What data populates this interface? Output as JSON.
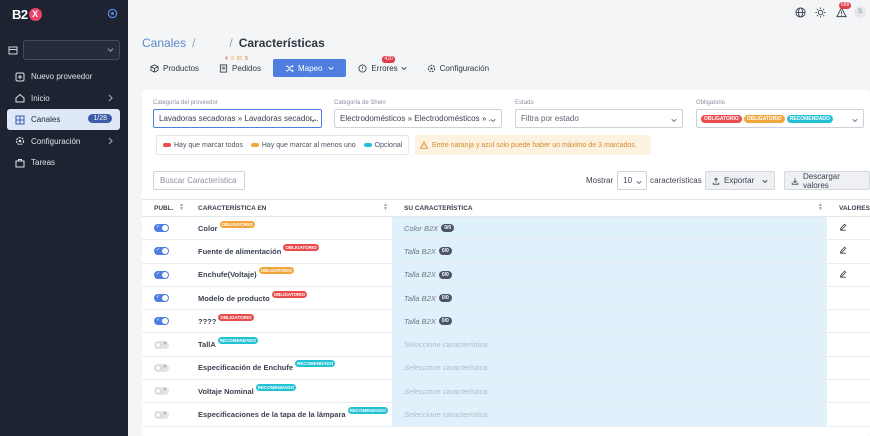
{
  "brand": {
    "logo_text": "B2",
    "logo_x": "X"
  },
  "sidebar": {
    "items": [
      {
        "label": "Nuevo proveedor",
        "icon": "plus-square-icon",
        "has_chevron": false
      },
      {
        "label": "Inicio",
        "icon": "home-icon",
        "has_chevron": true
      },
      {
        "label": "Canales",
        "icon": "grid-icon",
        "badge": "1/28",
        "active": true
      },
      {
        "label": "Configuración",
        "icon": "gear-icon",
        "has_chevron": true
      },
      {
        "label": "Tareas",
        "icon": "briefcase-icon",
        "has_chevron": false
      }
    ]
  },
  "topbar": {
    "notif_count": "688",
    "avatar_initial": "S"
  },
  "breadcrumb": {
    "root": "Canales",
    "sep1": "/",
    "sep2": "/",
    "title": "Características"
  },
  "tabs": [
    {
      "label": "Productos",
      "icon": "box-icon"
    },
    {
      "label": "Pedidos",
      "icon": "receipt-icon",
      "nums": [
        "4",
        "9",
        "85",
        "5"
      ]
    },
    {
      "label": "Mapeo",
      "icon": "shuffle-icon",
      "active": true
    },
    {
      "label": "Errores",
      "icon": "alert-circle-icon",
      "badge": "420"
    },
    {
      "label": "Configuración",
      "icon": "gear-icon"
    }
  ],
  "filters": {
    "provider_category": {
      "label": "Categoría del proveedor",
      "value": "Lavadoras secadoras » Lavadoras secador..."
    },
    "shein_category": {
      "label": "Categoría de Shein",
      "value": "Electrodomésticos » Electrodomésticos » ..."
    },
    "state": {
      "label": "Estado",
      "value": "Filtra por estado"
    },
    "required": {
      "label": "Obligatorio",
      "tags": [
        "OBLIGATORIO",
        "OBLIGATORIO",
        "RECOMENDADO"
      ]
    }
  },
  "legend": {
    "items": [
      {
        "label": "Hay que marcar todos",
        "color": "#e84c4c"
      },
      {
        "label": "Hay que marcar al menos uno",
        "color": "#f0a63a"
      },
      {
        "label": "Opcional",
        "color": "#22c1d6"
      }
    ],
    "warning": "Entre naranja y azul solo puede haber un máximo de 3 marcados."
  },
  "toolbar": {
    "search_placeholder": "Buscar Característica",
    "show_label": "Mostrar",
    "show_value": "10",
    "show_suffix": "características",
    "export_label": "Exportar",
    "download_label": "Descargar valores"
  },
  "table": {
    "headers": {
      "publ": "PUBL.",
      "char_en": "CARACTERÍSTICA EN",
      "your_char": "SU CARACTERÍSTICA",
      "values": "VALORES"
    },
    "rows": [
      {
        "name": "Color",
        "tag": "OBLIGATORIO",
        "tag_color": "#f0a63a",
        "on": true,
        "mapped": "Color B2X",
        "count": "0/0",
        "edit": true
      },
      {
        "name": "Fuente de alimentación",
        "tag": "OBLIGATORIO",
        "tag_color": "#e84c4c",
        "on": true,
        "mapped": "Talla B2X",
        "count": "0/0",
        "edit": true
      },
      {
        "name": "Enchufe(Voltaje)",
        "tag": "OBLIGATORIO",
        "tag_color": "#f0a63a",
        "on": true,
        "mapped": "Talla B2X",
        "count": "0/0",
        "edit": true
      },
      {
        "name": "Modelo de producto",
        "tag": "OBLIGATORIO",
        "tag_color": "#e84c4c",
        "on": true,
        "mapped": "Talla B2X",
        "count": "0/0",
        "edit": false
      },
      {
        "name": "????",
        "tag": "OBLIGATORIO",
        "tag_color": "#e84c4c",
        "on": true,
        "mapped": "Talla B2X",
        "count": "0/0",
        "edit": false
      },
      {
        "name": "TallA",
        "tag": "RECOMENDADO",
        "tag_color": "#22c1d6",
        "on": false,
        "mapped": "Seleccione característica",
        "count": "",
        "edit": false
      },
      {
        "name": "Especificación de Enchufe",
        "tag": "RECOMENDADO",
        "tag_color": "#22c1d6",
        "on": false,
        "mapped": "Seleccione característica",
        "count": "",
        "edit": false
      },
      {
        "name": "Voltaje Nominal",
        "tag": "RECOMENDADO",
        "tag_color": "#22c1d6",
        "on": false,
        "mapped": "Seleccione característica",
        "count": "",
        "edit": false
      },
      {
        "name": "Especificaciones de la tapa de la lámpara",
        "tag": "RECOMENDADO",
        "tag_color": "#22c1d6",
        "on": false,
        "mapped": "Seleccione característica",
        "count": "",
        "edit": false
      }
    ]
  }
}
